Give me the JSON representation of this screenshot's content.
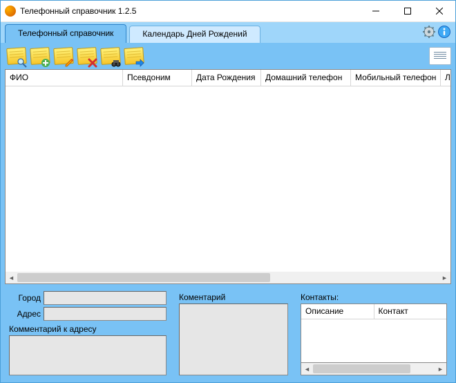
{
  "window": {
    "title": "Телефонный справочник 1.2.5"
  },
  "tabs": {
    "directory": "Телефонный справочник",
    "calendar": "Календарь Дней Рождений"
  },
  "grid": {
    "columns": {
      "fio": "ФИО",
      "alias": "Псевдоним",
      "dob": "Дата Рождения",
      "home": "Домашний телефон",
      "mobile": "Мобильный телефон",
      "more": "Л"
    }
  },
  "details": {
    "city_label": "Город",
    "city_value": "",
    "address_label": "Адрес",
    "address_value": "",
    "addr_comment_label": "Комментарий к адресу",
    "addr_comment_value": "",
    "comment_label": "Коментарий",
    "comment_value": "",
    "contacts_label": "Контакты:",
    "contacts_columns": {
      "desc": "Описание",
      "contact": "Контакт"
    }
  }
}
